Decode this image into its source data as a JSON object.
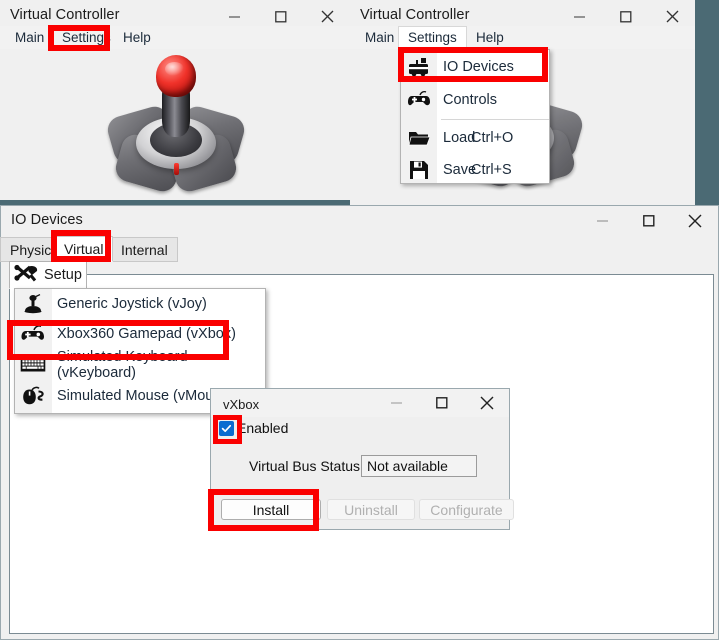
{
  "desktop": {
    "background_color": "#4b6a74"
  },
  "windows": {
    "main_left": {
      "title": "Virtual Controller",
      "menu": [
        {
          "label": "Main",
          "state": "normal"
        },
        {
          "label": "Settings",
          "state": "highlighted"
        },
        {
          "label": "Help",
          "state": "normal"
        }
      ],
      "controls": {
        "minimize": "—",
        "maximize": "□",
        "close": "✕"
      },
      "content_icon": "joystick-image"
    },
    "main_right": {
      "title": "Virtual Controller",
      "menu": [
        {
          "label": "Main",
          "state": "normal"
        },
        {
          "label": "Settings",
          "state": "open"
        },
        {
          "label": "Help",
          "state": "normal"
        }
      ],
      "controls": {
        "minimize": "—",
        "maximize": "□",
        "close": "✕"
      },
      "settings_menu": [
        {
          "label": "IO Devices",
          "accel": "",
          "icon": "toolbox-icon",
          "highlighted": true
        },
        {
          "label": "Controls",
          "accel": "",
          "icon": "gamepad-icon",
          "highlighted": false
        },
        {
          "separator": true
        },
        {
          "label": "Load",
          "accel": "Ctrl+O",
          "icon": "folder-icon",
          "highlighted": false
        },
        {
          "label": "Save",
          "accel": "Ctrl+S",
          "icon": "floppy-disk-icon",
          "highlighted": false
        }
      ]
    },
    "io_devices": {
      "title": "IO Devices",
      "controls": {
        "minimize": "—",
        "maximize": "□",
        "close": "✕"
      },
      "tabs": [
        {
          "label": "Physical",
          "active": false
        },
        {
          "label": "Virtual",
          "active": true,
          "highlighted": true
        },
        {
          "label": "Internal",
          "active": false
        }
      ],
      "setup_tab": {
        "label": "Setup",
        "icon": "tools-icon"
      },
      "setup_menu": [
        {
          "label": "Generic Joystick (vJoy)",
          "icon": "joystick-icon",
          "highlighted": false
        },
        {
          "label": "Xbox360 Gamepad (vXbox)",
          "icon": "gamepad-icon",
          "highlighted": true
        },
        {
          "label": "Simulated Keyboard (vKeyboard)",
          "icon": "keyboard-icon",
          "highlighted": false
        },
        {
          "label": "Simulated Mouse (vMouse)",
          "icon": "mouse-icon",
          "highlighted": false
        }
      ]
    },
    "vxbox_dialog": {
      "title": "vXbox",
      "controls": {
        "minimize": "—",
        "maximize": "□",
        "close": "✕"
      },
      "enabled_checkbox": {
        "label": "Enabled",
        "checked": true,
        "highlighted": true
      },
      "status_row": {
        "label": "Virtual Bus Status",
        "value": "Not available"
      },
      "buttons": [
        {
          "label": "Install",
          "enabled": true,
          "highlighted": true
        },
        {
          "label": "Uninstall",
          "enabled": false,
          "highlighted": false
        },
        {
          "label": "Configurate",
          "enabled": false,
          "highlighted": false
        }
      ]
    }
  },
  "annotation": {
    "color": "#fa0000",
    "count": 5
  }
}
